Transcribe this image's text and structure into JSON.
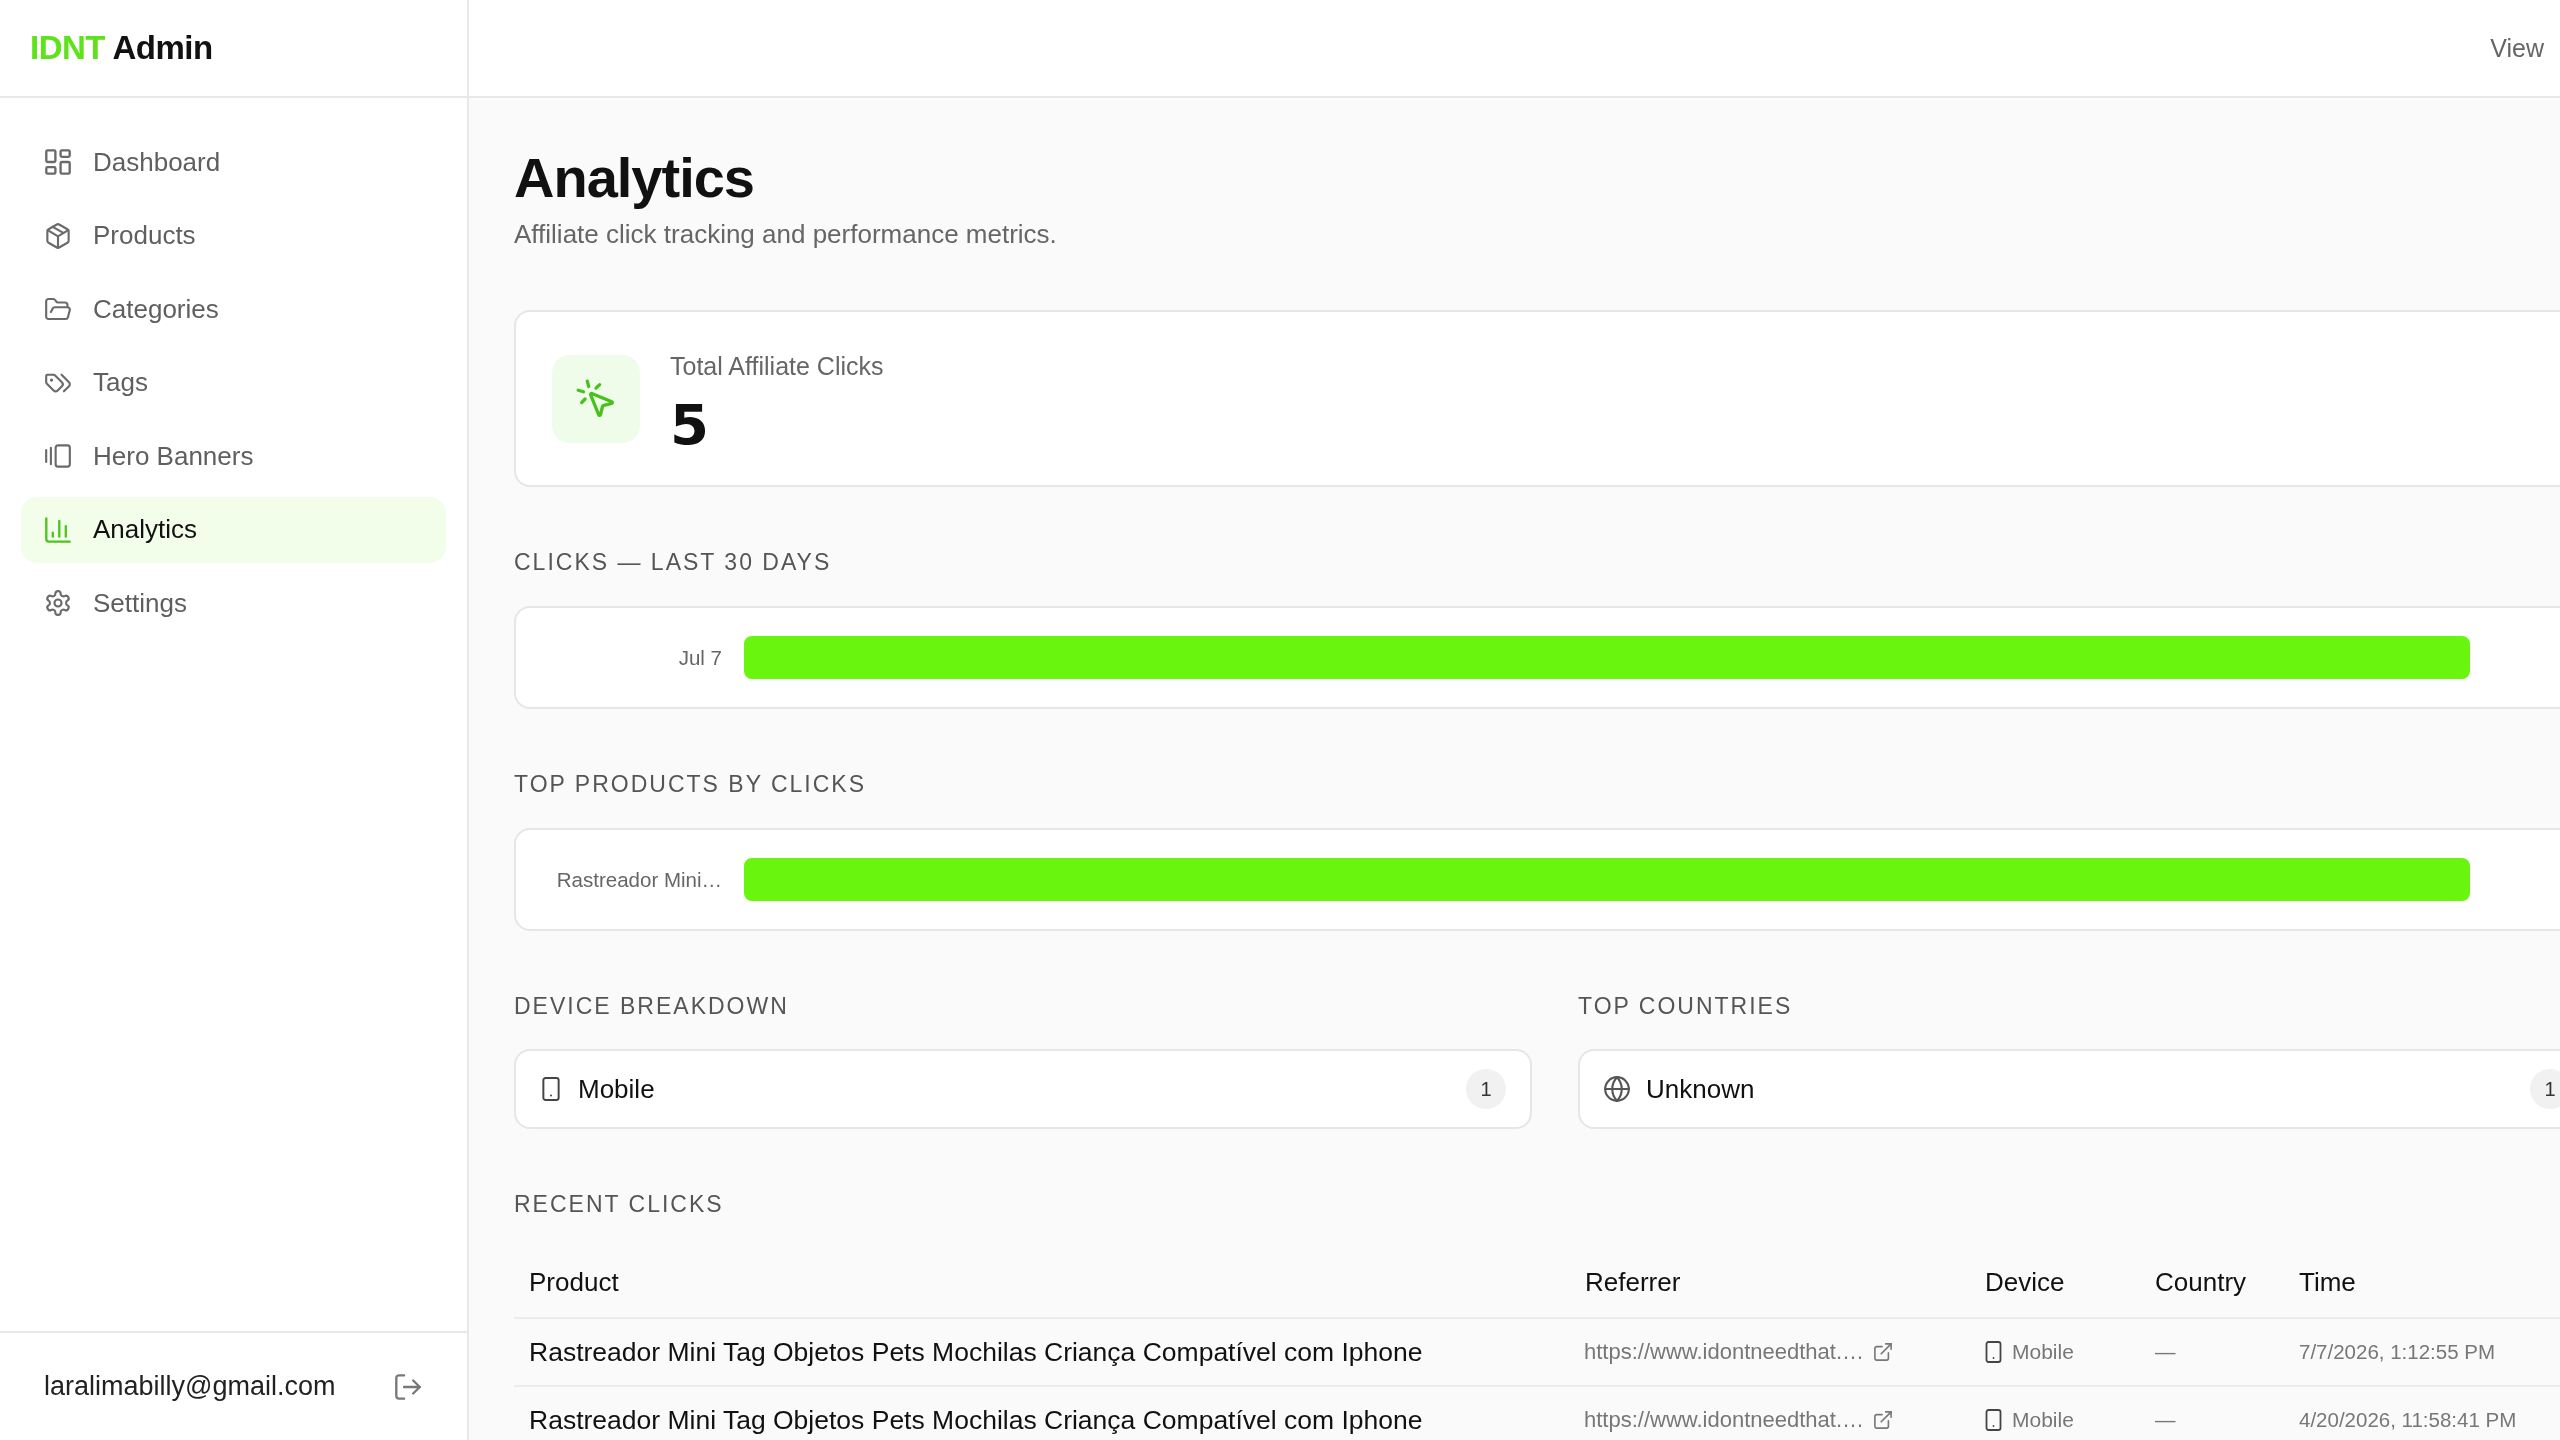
{
  "sidebar": {
    "logo": {
      "accent": "IDNT",
      "name": "Admin"
    },
    "nav_items": [
      {
        "label": "Dashboard",
        "selected": false
      },
      {
        "label": "Products",
        "selected": false
      },
      {
        "label": "Categories",
        "selected": false
      },
      {
        "label": "Tags",
        "selected": false
      },
      {
        "label": "Hero Banners",
        "selected": false
      },
      {
        "label": "Analytics",
        "selected": true
      },
      {
        "label": "Settings",
        "selected": false
      }
    ],
    "user_email": "laralimabilly@gmail.com"
  },
  "top_bar": {
    "link": "View"
  },
  "page": {
    "title": "Analytics",
    "subtitle": "Affiliate click tracking and performance metrics."
  },
  "stat_card": {
    "label": "Total Affiliate Clicks",
    "value": "5"
  },
  "clicks_last_30_days": {
    "heading": "CLICKS — LAST 30 DAYS",
    "bars": [
      {
        "label": "Jul 7",
        "level": 1
      }
    ]
  },
  "top_products": {
    "heading": "TOP PRODUCTS BY CLICKS",
    "bars": [
      {
        "label": "Rastreador Mini…",
        "level": 1
      }
    ]
  },
  "device_breakdown": {
    "heading": "DEVICE BREAKDOWN",
    "items": [
      {
        "label": "Mobile",
        "count": "1"
      }
    ]
  },
  "top_countries": {
    "heading": "TOP COUNTRIES",
    "items": [
      {
        "label": "Unknown",
        "count": "1"
      }
    ]
  },
  "recent_clicks": {
    "heading": "RECENT CLICKS",
    "columns": [
      "Product",
      "Referrer",
      "Device",
      "Country",
      "Time"
    ],
    "rows": [
      {
        "product": "Rastreador Mini Tag Objetos Pets Mochilas Criança Compatível com Iphone",
        "referrer": "https://www.idontneedthat.…",
        "device": "Mobile",
        "country": "—",
        "time": "7/7/2026, 1:12:55 PM"
      },
      {
        "product": "Rastreador Mini Tag Objetos Pets Mochilas Criança Compatível com Iphone",
        "referrer": "https://www.idontneedthat.…",
        "device": "Mobile",
        "country": "—",
        "time": "4/20/2026, 11:58:41 PM"
      }
    ]
  }
}
